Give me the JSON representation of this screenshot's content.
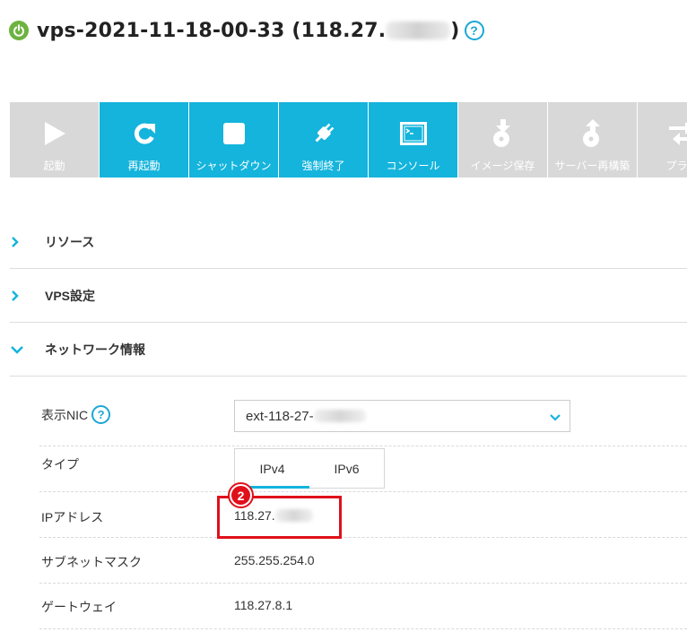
{
  "server": {
    "title_prefix": "vps-2021-11-18-00-33 (118.27.",
    "title_suffix": ")",
    "help_glyph": "?",
    "status_icon": "power-icon",
    "status_color": "#6cb33f"
  },
  "toolbar": {
    "accent_color": "#14b4dc",
    "disabled_color": "#d8d8d8",
    "buttons": [
      {
        "label": "起動",
        "icon": "play-icon",
        "enabled": false
      },
      {
        "label": "再起動",
        "icon": "restart-icon",
        "enabled": true
      },
      {
        "label": "シャットダウン",
        "icon": "stop-icon",
        "enabled": true
      },
      {
        "label": "強制終了",
        "icon": "plug-icon",
        "enabled": true
      },
      {
        "label": "コンソール",
        "icon": "console-icon",
        "enabled": true
      },
      {
        "label": "イメージ保存",
        "icon": "image-save-icon",
        "enabled": false
      },
      {
        "label": "サーバー再構築",
        "icon": "server-rebuild-icon",
        "enabled": false
      },
      {
        "label": "プラン",
        "icon": "plan-change-icon",
        "enabled": false
      }
    ]
  },
  "sections": [
    {
      "label": "リソース",
      "expanded": false
    },
    {
      "label": "VPS設定",
      "expanded": false
    },
    {
      "label": "ネットワーク情報",
      "expanded": true
    }
  ],
  "network": {
    "nic_label": "表示NIC",
    "nic_help_glyph": "?",
    "nic_value_prefix": "ext-118-27-",
    "type_label": "タイプ",
    "tabs": [
      {
        "label": "IPv4",
        "selected": true
      },
      {
        "label": "IPv6",
        "selected": false
      }
    ],
    "ip_label": "IPアドレス",
    "ip_value_prefix": "118.27.",
    "subnet_label": "サブネットマスク",
    "subnet_value": "255.255.254.0",
    "gateway_label": "ゲートウェイ",
    "gateway_value": "118.27.8.1"
  },
  "annotation": {
    "step_number": "2",
    "color": "#e0101a"
  }
}
